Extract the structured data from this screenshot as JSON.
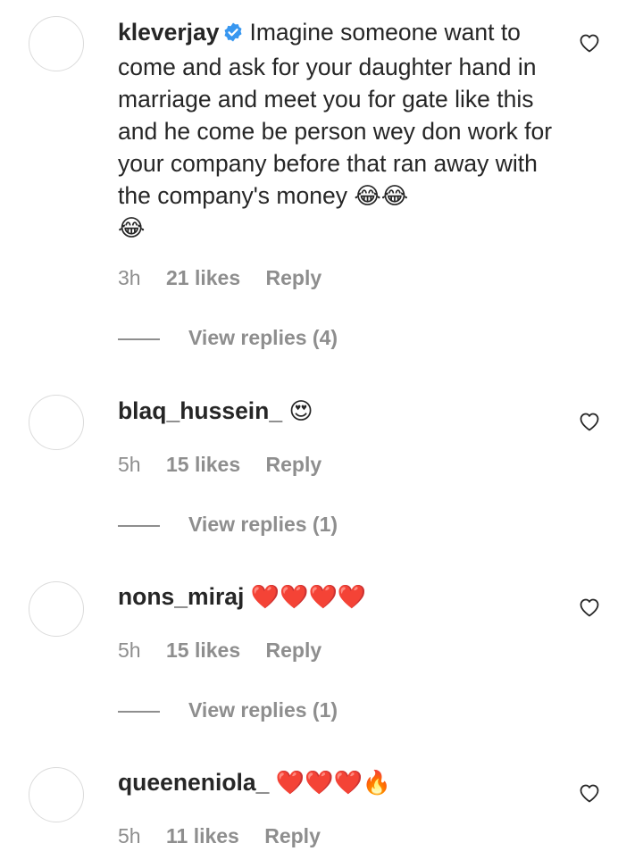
{
  "comments": [
    {
      "username": "kleverjay",
      "verified": true,
      "text": "Imagine someone want to come and ask for your daughter hand in marriage and meet you for gate like this and he come be person wey don work for your company before that ran away with the company's money",
      "emoji_end": "😂😂",
      "emoji_line2": "😂",
      "time": "3h",
      "likes": "21 likes",
      "reply": "Reply",
      "view_replies": "View replies (4)"
    },
    {
      "username": "blaq_hussein_",
      "verified": false,
      "text": "😍",
      "time": "5h",
      "likes": "15 likes",
      "reply": "Reply",
      "view_replies": "View replies (1)"
    },
    {
      "username": "nons_miraj",
      "verified": false,
      "text": "❤️❤️❤️❤️",
      "time": "5h",
      "likes": "15 likes",
      "reply": "Reply",
      "view_replies": "View replies (1)"
    },
    {
      "username": "queeneniola_",
      "verified": false,
      "text": "❤️❤️❤️🔥",
      "time": "5h",
      "likes": "11 likes",
      "reply": "Reply"
    }
  ],
  "icons": {
    "like": "heart-outline-icon",
    "verified": "verified-badge-icon"
  },
  "colors": {
    "verified": "#3897f0",
    "muted": "#8e8e8e",
    "text": "#262626"
  }
}
